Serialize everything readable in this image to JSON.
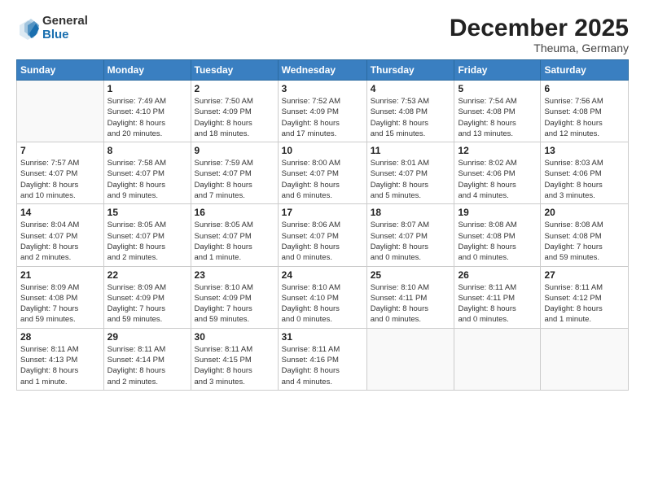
{
  "header": {
    "logo": {
      "general": "General",
      "blue": "Blue"
    },
    "title": "December 2025",
    "subtitle": "Theuma, Germany"
  },
  "weekdays": [
    "Sunday",
    "Monday",
    "Tuesday",
    "Wednesday",
    "Thursday",
    "Friday",
    "Saturday"
  ],
  "weeks": [
    [
      {
        "day": "",
        "info": ""
      },
      {
        "day": "1",
        "info": "Sunrise: 7:49 AM\nSunset: 4:10 PM\nDaylight: 8 hours\nand 20 minutes."
      },
      {
        "day": "2",
        "info": "Sunrise: 7:50 AM\nSunset: 4:09 PM\nDaylight: 8 hours\nand 18 minutes."
      },
      {
        "day": "3",
        "info": "Sunrise: 7:52 AM\nSunset: 4:09 PM\nDaylight: 8 hours\nand 17 minutes."
      },
      {
        "day": "4",
        "info": "Sunrise: 7:53 AM\nSunset: 4:08 PM\nDaylight: 8 hours\nand 15 minutes."
      },
      {
        "day": "5",
        "info": "Sunrise: 7:54 AM\nSunset: 4:08 PM\nDaylight: 8 hours\nand 13 minutes."
      },
      {
        "day": "6",
        "info": "Sunrise: 7:56 AM\nSunset: 4:08 PM\nDaylight: 8 hours\nand 12 minutes."
      }
    ],
    [
      {
        "day": "7",
        "info": "Sunrise: 7:57 AM\nSunset: 4:07 PM\nDaylight: 8 hours\nand 10 minutes."
      },
      {
        "day": "8",
        "info": "Sunrise: 7:58 AM\nSunset: 4:07 PM\nDaylight: 8 hours\nand 9 minutes."
      },
      {
        "day": "9",
        "info": "Sunrise: 7:59 AM\nSunset: 4:07 PM\nDaylight: 8 hours\nand 7 minutes."
      },
      {
        "day": "10",
        "info": "Sunrise: 8:00 AM\nSunset: 4:07 PM\nDaylight: 8 hours\nand 6 minutes."
      },
      {
        "day": "11",
        "info": "Sunrise: 8:01 AM\nSunset: 4:07 PM\nDaylight: 8 hours\nand 5 minutes."
      },
      {
        "day": "12",
        "info": "Sunrise: 8:02 AM\nSunset: 4:06 PM\nDaylight: 8 hours\nand 4 minutes."
      },
      {
        "day": "13",
        "info": "Sunrise: 8:03 AM\nSunset: 4:06 PM\nDaylight: 8 hours\nand 3 minutes."
      }
    ],
    [
      {
        "day": "14",
        "info": "Sunrise: 8:04 AM\nSunset: 4:07 PM\nDaylight: 8 hours\nand 2 minutes."
      },
      {
        "day": "15",
        "info": "Sunrise: 8:05 AM\nSunset: 4:07 PM\nDaylight: 8 hours\nand 2 minutes."
      },
      {
        "day": "16",
        "info": "Sunrise: 8:05 AM\nSunset: 4:07 PM\nDaylight: 8 hours\nand 1 minute."
      },
      {
        "day": "17",
        "info": "Sunrise: 8:06 AM\nSunset: 4:07 PM\nDaylight: 8 hours\nand 0 minutes."
      },
      {
        "day": "18",
        "info": "Sunrise: 8:07 AM\nSunset: 4:07 PM\nDaylight: 8 hours\nand 0 minutes."
      },
      {
        "day": "19",
        "info": "Sunrise: 8:08 AM\nSunset: 4:08 PM\nDaylight: 8 hours\nand 0 minutes."
      },
      {
        "day": "20",
        "info": "Sunrise: 8:08 AM\nSunset: 4:08 PM\nDaylight: 7 hours\nand 59 minutes."
      }
    ],
    [
      {
        "day": "21",
        "info": "Sunrise: 8:09 AM\nSunset: 4:08 PM\nDaylight: 7 hours\nand 59 minutes."
      },
      {
        "day": "22",
        "info": "Sunrise: 8:09 AM\nSunset: 4:09 PM\nDaylight: 7 hours\nand 59 minutes."
      },
      {
        "day": "23",
        "info": "Sunrise: 8:10 AM\nSunset: 4:09 PM\nDaylight: 7 hours\nand 59 minutes."
      },
      {
        "day": "24",
        "info": "Sunrise: 8:10 AM\nSunset: 4:10 PM\nDaylight: 8 hours\nand 0 minutes."
      },
      {
        "day": "25",
        "info": "Sunrise: 8:10 AM\nSunset: 4:11 PM\nDaylight: 8 hours\nand 0 minutes."
      },
      {
        "day": "26",
        "info": "Sunrise: 8:11 AM\nSunset: 4:11 PM\nDaylight: 8 hours\nand 0 minutes."
      },
      {
        "day": "27",
        "info": "Sunrise: 8:11 AM\nSunset: 4:12 PM\nDaylight: 8 hours\nand 1 minute."
      }
    ],
    [
      {
        "day": "28",
        "info": "Sunrise: 8:11 AM\nSunset: 4:13 PM\nDaylight: 8 hours\nand 1 minute."
      },
      {
        "day": "29",
        "info": "Sunrise: 8:11 AM\nSunset: 4:14 PM\nDaylight: 8 hours\nand 2 minutes."
      },
      {
        "day": "30",
        "info": "Sunrise: 8:11 AM\nSunset: 4:15 PM\nDaylight: 8 hours\nand 3 minutes."
      },
      {
        "day": "31",
        "info": "Sunrise: 8:11 AM\nSunset: 4:16 PM\nDaylight: 8 hours\nand 4 minutes."
      },
      {
        "day": "",
        "info": ""
      },
      {
        "day": "",
        "info": ""
      },
      {
        "day": "",
        "info": ""
      }
    ]
  ]
}
